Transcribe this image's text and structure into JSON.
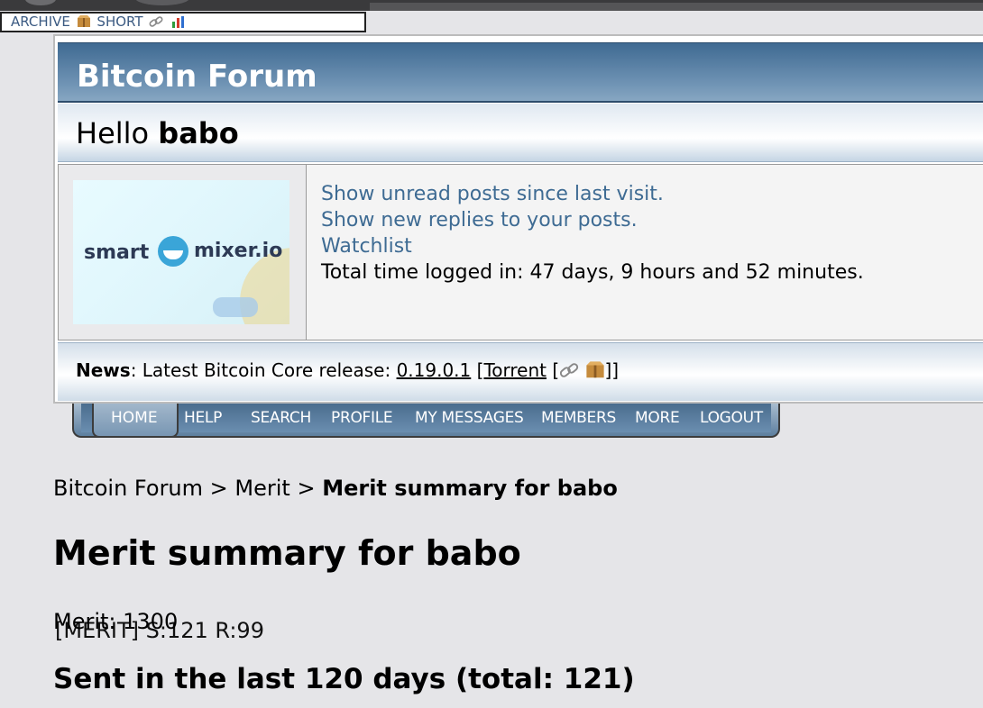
{
  "extension_bar": {
    "archive": "ARCHIVE",
    "short": "SHORT",
    "merit_info": "[MERIT] S:121 R:99"
  },
  "forum": {
    "title": "Bitcoin Forum",
    "hello_prefix": "Hello ",
    "username": "babo",
    "ad": {
      "word1": "smart",
      "word2": "mixer.io"
    },
    "links": {
      "unread": "Show unread posts since last visit.",
      "replies": "Show new replies to your posts.",
      "watchlist": "Watchlist"
    },
    "time_logged": "Total time logged in: 47 days, 9 hours and 52 minutes.",
    "news": {
      "label": "News",
      "text": ": Latest Bitcoin Core release: ",
      "version": "0.19.0.1",
      "open": " [",
      "torrent": "Torrent",
      "bracket": " [",
      "close": "]]"
    }
  },
  "menu": {
    "home": "HOME",
    "help": "HELP",
    "search": "SEARCH",
    "profile": "PROFILE",
    "messages": "MY MESSAGES",
    "members": "MEMBERS",
    "more": "MORE",
    "logout": "LOGOUT"
  },
  "breadcrumb": {
    "root": "Bitcoin Forum",
    "sep1": " > ",
    "merit": "Merit",
    "sep2": " > ",
    "current": "Merit summary for babo"
  },
  "page": {
    "heading": "Merit summary for babo",
    "merit_line": "Merit: 1300",
    "sent_heading": "Sent in the last 120 days (total: 121)"
  }
}
